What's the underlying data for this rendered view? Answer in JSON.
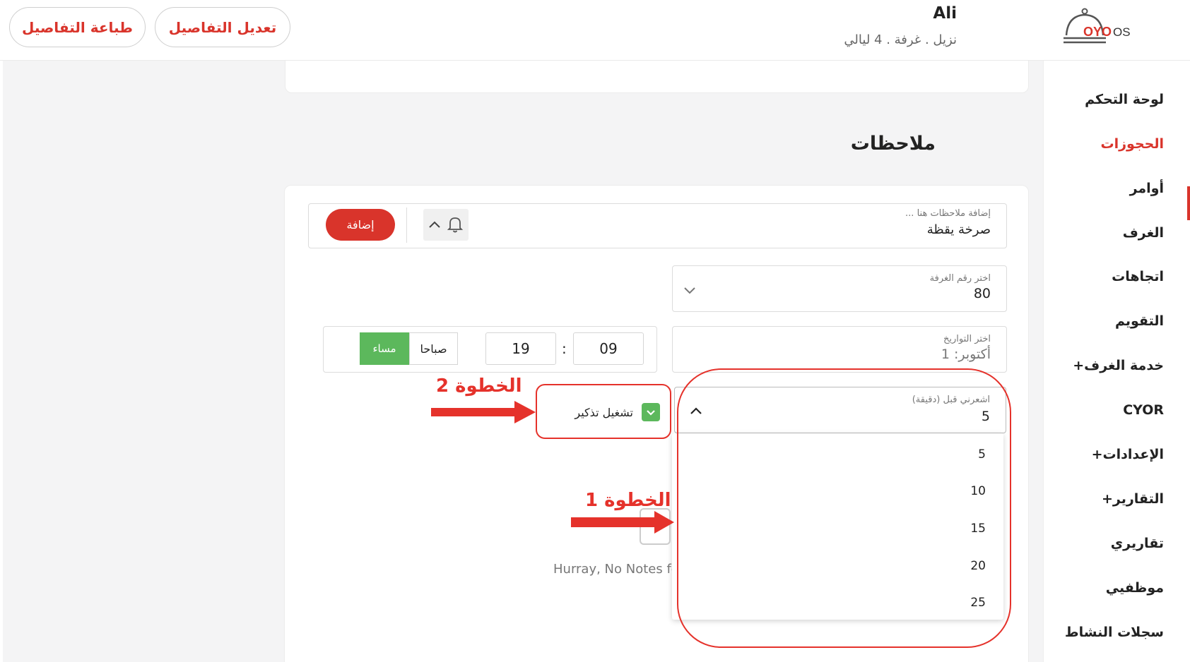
{
  "header": {
    "print_button": "طباعة التفاصيل",
    "edit_button": "تعديل التفاصيل",
    "guest_name": "Ali",
    "guest_subtitle": "نزيل . غرفة . 4 ليالي",
    "logo_text": "OYO OS"
  },
  "sidebar": {
    "items": [
      {
        "label": "لوحة التحكم"
      },
      {
        "label": "الحجوزات",
        "active": true
      },
      {
        "label": "أوامر"
      },
      {
        "label": "الغرف"
      },
      {
        "label": "اتجاهات"
      },
      {
        "label": "التقويم"
      },
      {
        "label": "خدمة الغرف+"
      },
      {
        "label": "CYOR"
      },
      {
        "label": "الإعدادات+"
      },
      {
        "label": "التقارير+"
      },
      {
        "label": "تقاريري"
      },
      {
        "label": "موظفيي"
      },
      {
        "label": "سجلات النشاط"
      }
    ]
  },
  "notes": {
    "section_title": "ملاحظات",
    "note_input": {
      "label": "إضافة ملاحظات هنا ...",
      "value": "صرخة يقظة"
    },
    "add_button": "إضافة",
    "room_select": {
      "label": "اختر رقم الغرفة",
      "value": "80"
    },
    "date_select": {
      "label": "اختر التواريخ",
      "value": "أكتوبر: 1"
    },
    "time": {
      "hour": "09",
      "separator": ":",
      "minute": "19",
      "am_label": "صباحا",
      "pm_label": "مساء",
      "selected": "pm"
    },
    "notify_before": {
      "label": "اشعرني قبل (دقيقة)",
      "value": "5",
      "options": [
        "5",
        "10",
        "15",
        "20",
        "25"
      ]
    },
    "reminder_checkbox": {
      "label": "تشغيل تذكير",
      "checked": true
    },
    "empty_text": "Hurray, No Notes fo"
  },
  "annotations": {
    "step1": "الخطوة 1",
    "step2": "الخطوة 2"
  },
  "colors": {
    "brand_red": "#d9342b",
    "green": "#5cb85c",
    "annotation_red": "#e5322b"
  }
}
